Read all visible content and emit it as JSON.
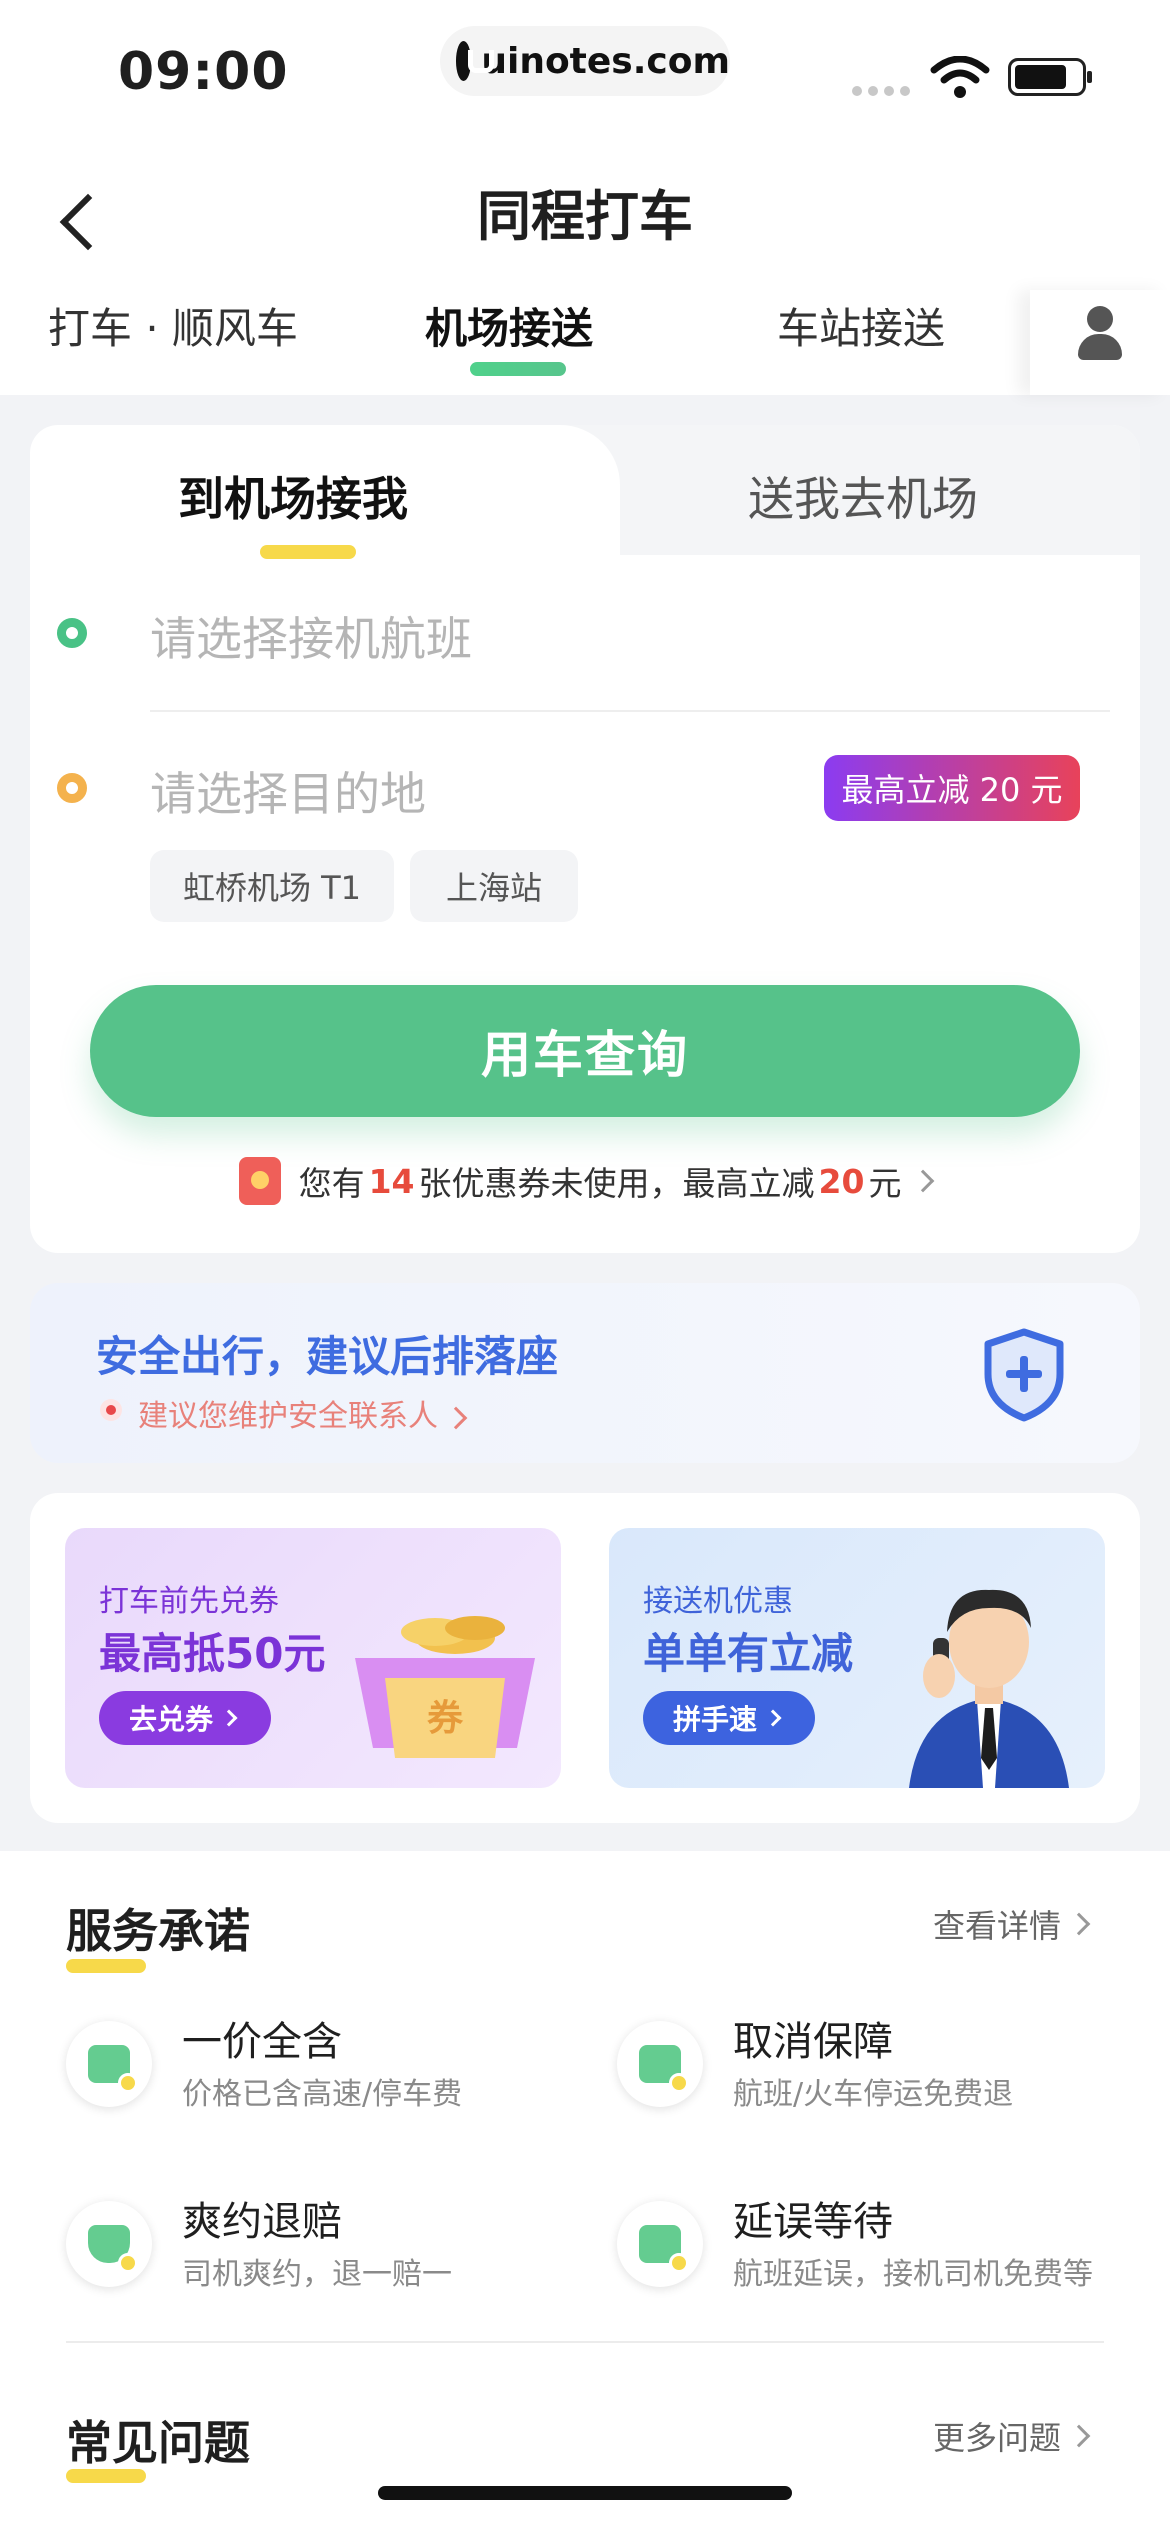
{
  "status_bar": {
    "time": "09:00",
    "url": "uinotes.com"
  },
  "nav": {
    "title": "同程打车",
    "tabs": [
      "打车 · 顺风车",
      "机场接送",
      "车站接送"
    ],
    "active_tab": "机场接送"
  },
  "booking": {
    "segments": [
      "到机场接我",
      "送我去机场"
    ],
    "active_segment": "到机场接我",
    "flight_placeholder": "请选择接机航班",
    "destination_placeholder": "请选择目的地",
    "promo_badge": "最高立减 20 元",
    "quick_chips": [
      "虹桥机场 T1",
      "上海站"
    ],
    "search_button": "用车查询",
    "coupon": {
      "prefix": "您有",
      "count": "14",
      "middle": "张优惠券未使用，最高立减",
      "amount": "20",
      "suffix": "元"
    }
  },
  "safety": {
    "title": "安全出行，建议后排落座",
    "subtitle": "建议您维护安全联系人"
  },
  "banners": [
    {
      "subtitle": "打车前先兑券",
      "title": "最高抵50元",
      "button": "去兑券",
      "coupon_stamp": "券"
    },
    {
      "subtitle": "接送机优惠",
      "title": "单单有立减",
      "button": "拼手速"
    }
  ],
  "services": {
    "title": "服务承诺",
    "link": "查看详情",
    "items": [
      {
        "title": "一价全含",
        "subtitle": "价格已含高速/停车费",
        "icon": "car-icon"
      },
      {
        "title": "取消保障",
        "subtitle": "航班/火车停运免费退",
        "icon": "ticket-icon"
      },
      {
        "title": "爽约退赔",
        "subtitle": "司机爽约，退一赔一",
        "icon": "shield-yuan-icon"
      },
      {
        "title": "延误等待",
        "subtitle": "航班延误，接机司机免费等",
        "icon": "driver-icon"
      }
    ]
  },
  "faq": {
    "title": "常见问题",
    "link": "更多问题"
  },
  "colors": {
    "primary_green": "#56c28a",
    "accent_yellow": "#f7d94a",
    "safety_blue": "#3f6ce0",
    "price_red": "#e74b3c",
    "promo_gradient_start": "#8b3cf1",
    "promo_gradient_end": "#e8425a"
  }
}
